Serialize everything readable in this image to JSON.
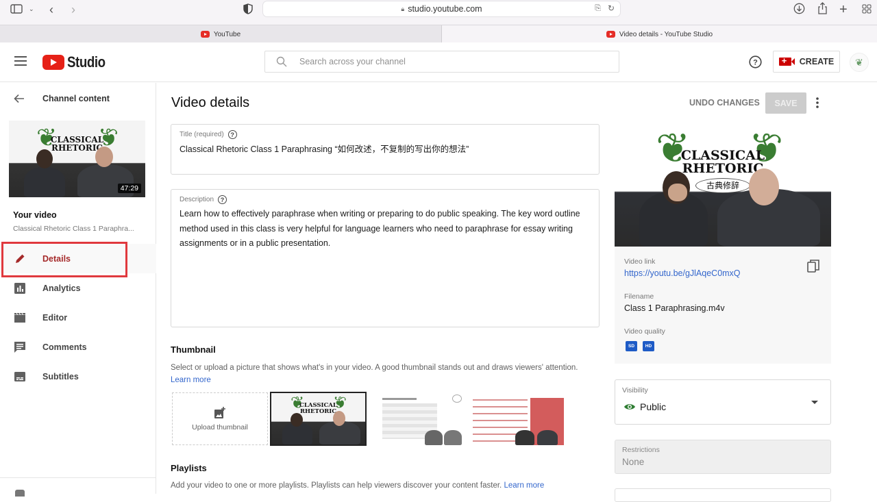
{
  "browser": {
    "url": "studio.youtube.com",
    "tabs": [
      {
        "label": "YouTube",
        "active": false
      },
      {
        "label": "Video details - YouTube Studio",
        "active": true
      }
    ]
  },
  "header": {
    "logo_text": "Studio",
    "search_placeholder": "Search across your channel",
    "create_label": "CREATE"
  },
  "sidebar": {
    "back_label": "Channel content",
    "thumbnail_title_line1": "CLASSICAL",
    "thumbnail_title_line2": "RHETORIC",
    "thumbnail_subtitle": "古典修辞",
    "duration": "47:29",
    "your_video_label": "Your video",
    "video_title_truncated": "Classical Rhetoric Class 1 Paraphra...",
    "items": [
      {
        "label": "Details",
        "icon": "pencil-icon",
        "active": true
      },
      {
        "label": "Analytics",
        "icon": "analytics-icon",
        "active": false
      },
      {
        "label": "Editor",
        "icon": "clapperboard-icon",
        "active": false
      },
      {
        "label": "Comments",
        "icon": "comment-icon",
        "active": false
      },
      {
        "label": "Subtitles",
        "icon": "subtitles-icon",
        "active": false
      }
    ]
  },
  "main": {
    "page_title": "Video details",
    "undo_label": "UNDO CHANGES",
    "save_label": "SAVE",
    "title_field": {
      "label": "Title (required)",
      "value": "Classical Rhetoric Class 1 Paraphrasing “如何改述，不复制的写出你的想法”"
    },
    "description_field": {
      "label": "Description",
      "value": "Learn how to effectively paraphrase when writing or preparing to do public speaking. The key word outline method used in this class is very helpful for language learners who need to paraphrase for essay writing assignments or in a public presentation."
    },
    "thumbnail": {
      "title": "Thumbnail",
      "description": "Select or upload a picture that shows what's in your video. A good thumbnail stands out and draws viewers' attention.",
      "learn_more": "Learn more",
      "upload_label": "Upload thumbnail"
    },
    "playlists": {
      "title": "Playlists",
      "description": "Add your video to one or more playlists. Playlists can help viewers discover your content faster.",
      "learn_more": "Learn more"
    }
  },
  "info_card": {
    "video_link_label": "Video link",
    "video_link": "https://youtu.be/gJlAqeC0mxQ",
    "filename_label": "Filename",
    "filename": "Class 1 Paraphrasing.m4v",
    "quality_label": "Video quality",
    "quality_badges": [
      "SD",
      "HD"
    ]
  },
  "visibility": {
    "label": "Visibility",
    "value": "Public"
  },
  "restrictions": {
    "label": "Restrictions",
    "value": "None"
  },
  "colors": {
    "brand_red": "#e62117",
    "active_nav": "#a52a2a",
    "highlight_box": "#e0393e",
    "link": "#3366cc",
    "public_eye": "#2e7d32",
    "quality_badge": "#1e5bc6"
  }
}
